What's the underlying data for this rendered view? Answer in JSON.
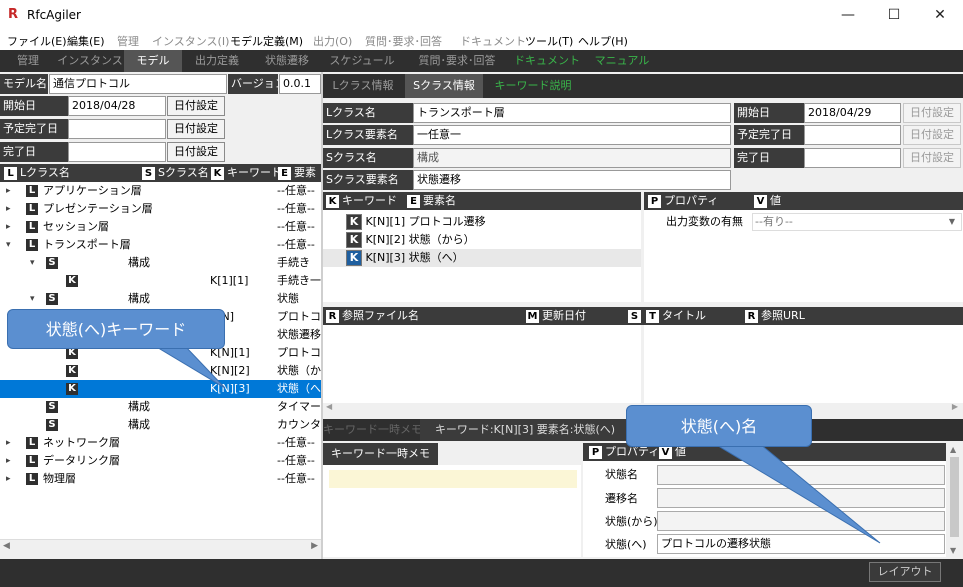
{
  "app": {
    "title": "RfcAgiler",
    "icon_glyph": "R"
  },
  "window": {
    "minimize": "—",
    "maximize": "☐",
    "close": "✕"
  },
  "menu": [
    {
      "label": "ファイル(E)",
      "dim": false
    },
    {
      "label": "編集(E)",
      "dim": false
    },
    {
      "label": "管理",
      "dim": true
    },
    {
      "label": "インスタンス(I)",
      "dim": true
    },
    {
      "label": "モデル定義(M)",
      "dim": false
    },
    {
      "label": "出力(O)",
      "dim": true
    },
    {
      "label": "質問･要求･回答",
      "dim": true
    },
    {
      "label": "ドキュメント",
      "dim": true
    },
    {
      "label": "ツール(T)",
      "dim": false
    },
    {
      "label": "ヘルプ(H)",
      "dim": false
    }
  ],
  "main_tabs": [
    "管理",
    "インスタンス",
    "モデル",
    "出力定義",
    "状態遷移",
    "スケジュール",
    "質問･要求･回答",
    "ドキュメント",
    "マニュアル"
  ],
  "model": {
    "name_label": "モデル名",
    "name_value": "通信プロトコル",
    "version_label": "バージョン",
    "version_value": "0.0.1",
    "start_label": "開始日",
    "start_value": "2018/04/28",
    "start_btn": "日付設定",
    "plan_label": "予定完了日",
    "plan_value": "",
    "plan_btn": "日付設定",
    "done_label": "完了日",
    "done_value": "",
    "done_btn": "日付設定"
  },
  "tree_header": {
    "l": "L",
    "l_label": "Lクラス名",
    "s": "S",
    "s_label": "Sクラス名",
    "k": "K",
    "k_label": "キーワード",
    "e": "E",
    "e_label": "要素"
  },
  "tree": [
    {
      "badge": "L",
      "name": "アプリケーション層",
      "col2": "",
      "col3": "",
      "col4": "--任意--",
      "expand": "▸"
    },
    {
      "badge": "L",
      "name": "プレゼンテーション層",
      "col2": "",
      "col3": "",
      "col4": "--任意--",
      "expand": "▸"
    },
    {
      "badge": "L",
      "name": "セッション層",
      "col2": "",
      "col3": "",
      "col4": "--任意--",
      "expand": "▸"
    },
    {
      "badge": "L",
      "name": "トランスポート層",
      "col2": "",
      "col3": "",
      "col4": "--任意--",
      "expand": "▾"
    },
    {
      "badge": "S",
      "name": "",
      "col2": "構成",
      "col3": "",
      "col4": "手続き",
      "expand": "▾"
    },
    {
      "badge": "K",
      "name": "",
      "col2": "",
      "col3": "K[1][1]",
      "col4": "手続き一",
      "expand": ""
    },
    {
      "badge": "S",
      "name": "",
      "col2": "構成",
      "col3": "",
      "col4": "状態",
      "expand": "▾"
    },
    {
      "badge": "K",
      "name": "",
      "col2": "",
      "col3": "K[N]",
      "col4": "プロトコル",
      "expand": ""
    },
    {
      "badge": "K",
      "name": "",
      "col2": "",
      "col3": "",
      "col4": "状態遷移",
      "expand": ""
    },
    {
      "badge": "K",
      "name": "",
      "col2": "",
      "col3": "K[N][1]",
      "col4": "プロトコル",
      "expand": ""
    },
    {
      "badge": "K",
      "name": "",
      "col2": "",
      "col3": "K[N][2]",
      "col4": "状態（か",
      "expand": ""
    },
    {
      "badge": "K",
      "name": "",
      "col2": "",
      "col3": "K[N][3]",
      "col4": "状態（へ",
      "expand": "",
      "selected": true
    },
    {
      "badge": "S",
      "name": "",
      "col2": "構成",
      "col3": "",
      "col4": "タイマー",
      "expand": ""
    },
    {
      "badge": "S",
      "name": "",
      "col2": "構成",
      "col3": "",
      "col4": "カウンター",
      "expand": ""
    },
    {
      "badge": "L",
      "name": "ネットワーク層",
      "col2": "",
      "col3": "",
      "col4": "--任意--",
      "expand": "▸"
    },
    {
      "badge": "L",
      "name": "データリンク層",
      "col2": "",
      "col3": "",
      "col4": "--任意--",
      "expand": "▸"
    },
    {
      "badge": "L",
      "name": "物理層",
      "col2": "",
      "col3": "",
      "col4": "--任意--",
      "expand": "▸"
    }
  ],
  "callouts": {
    "left": "状態(へ)キーワード",
    "right": "状態(へ)名"
  },
  "sub_tabs": [
    "Lクラス情報",
    "Sクラス情報",
    "キーワード説明"
  ],
  "sclass": {
    "lname_label": "Lクラス名",
    "lname_value": "トランスポート層",
    "lelem_label": "Lクラス要素名",
    "lelem_value": "一任意一",
    "sname_label": "Sクラス名",
    "sname_value": "構成",
    "selem_label": "Sクラス要素名",
    "selem_value": "状態遷移",
    "start_label": "開始日",
    "start_value": "2018/04/29",
    "start_btn": "日付設定",
    "plan_label": "予定完了日",
    "plan_value": "",
    "plan_btn": "日付設定",
    "done_label": "完了日",
    "done_value": "",
    "done_btn": "日付設定"
  },
  "kw_header": {
    "k": "K",
    "k_label": "キーワード",
    "e": "E",
    "e_label": "要素名"
  },
  "keywords": [
    {
      "key": "K[N][1]",
      "name": "プロトコル遷移"
    },
    {
      "key": "K[N][2]",
      "name": "状態（から）"
    },
    {
      "key": "K[N][3]",
      "name": "状態（へ）"
    }
  ],
  "prop_header": {
    "p": "P",
    "p_label": "プロパティ",
    "v": "V",
    "v_label": "値"
  },
  "props": [
    {
      "name": "出力変数の有無",
      "value": "--有り--"
    }
  ],
  "ref_header": {
    "r": "R",
    "r_label": "参照ファイル名",
    "m": "M",
    "m_label": "更新日付",
    "s": "S",
    "t": "T",
    "t_label": "タイトル",
    "r2": "R",
    "r2_label": "参照URL"
  },
  "bottom": {
    "tab1": "キーワード一時メモ",
    "tab2": "キーワード:K[N][3] 要素名:状態(へ)",
    "memo_label": "キーワード一時メモ",
    "p": "P",
    "p_label": "プロパティ",
    "v": "V",
    "v_label": "値",
    "rows": [
      {
        "name": "状態名",
        "value": ""
      },
      {
        "name": "遷移名",
        "value": ""
      },
      {
        "name": "状態(から)",
        "value": ""
      },
      {
        "name": "状態(へ)",
        "value": "プロトコルの遷移状態"
      }
    ]
  },
  "status": {
    "layout_button": "レイアウト"
  },
  "colors": {
    "selection": "#0078d7",
    "dark": "#2f2f2f",
    "callout": "#5b8fd0",
    "accent_green": "#39b54a"
  }
}
